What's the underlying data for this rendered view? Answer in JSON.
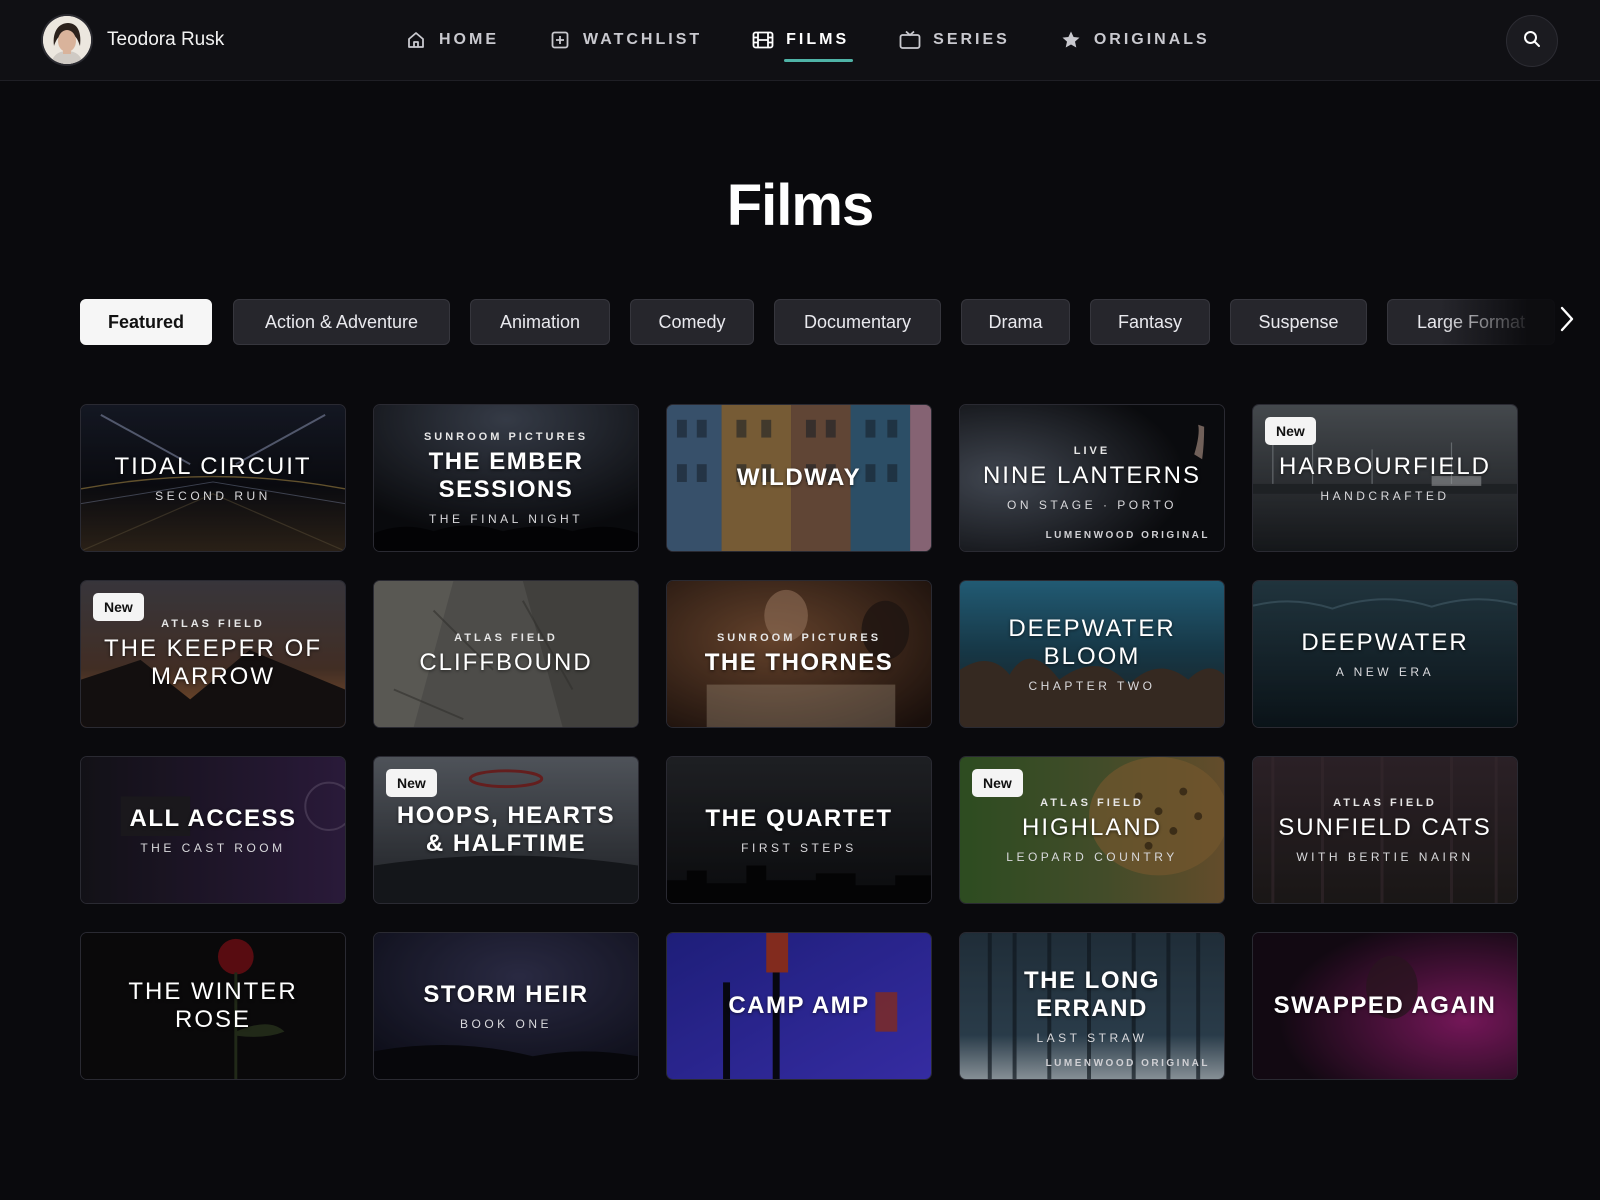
{
  "profile": {
    "name": "Teodora Rusk"
  },
  "nav": [
    {
      "label": "HOME",
      "icon": "home-icon",
      "active": false
    },
    {
      "label": "WATCHLIST",
      "icon": "plus-square-icon",
      "active": false
    },
    {
      "label": "FILMS",
      "icon": "film-icon",
      "active": true
    },
    {
      "label": "SERIES",
      "icon": "tv-icon",
      "active": false
    },
    {
      "label": "ORIGINALS",
      "icon": "star-icon",
      "active": false
    }
  ],
  "page": {
    "title": "Films"
  },
  "genres": [
    {
      "label": "Featured",
      "active": true
    },
    {
      "label": "Action & Adventure",
      "active": false
    },
    {
      "label": "Animation",
      "active": false
    },
    {
      "label": "Comedy",
      "active": false
    },
    {
      "label": "Documentary",
      "active": false
    },
    {
      "label": "Drama",
      "active": false
    },
    {
      "label": "Fantasy",
      "active": false
    },
    {
      "label": "Suspense",
      "active": false
    },
    {
      "label": "Large Format",
      "active": false
    }
  ],
  "colors": {
    "accent": "#4fb3a7",
    "chip_active_bg": "#f6f6f6",
    "chip_bg": "#26262c"
  },
  "cards": [
    {
      "title": "TIDAL CIRCUIT",
      "subtitle": "SECOND RUN",
      "kicker": "",
      "corner": "",
      "badge": ""
    },
    {
      "title": "THE EMBER SESSIONS",
      "subtitle": "THE FINAL NIGHT",
      "kicker": "SUNROOM PICTURES",
      "corner": "",
      "badge": ""
    },
    {
      "title": "WILDWAY",
      "subtitle": "",
      "kicker": "",
      "corner": "",
      "badge": ""
    },
    {
      "title": "NINE LANTERNS",
      "subtitle": "ON STAGE · PORTO",
      "kicker": "LIVE",
      "corner": "LUMENWOOD ORIGINAL",
      "badge": ""
    },
    {
      "title": "HARBOURFIELD",
      "subtitle": "HANDCRAFTED",
      "kicker": "",
      "corner": "",
      "badge": "New"
    },
    {
      "title": "THE KEEPER OF MARROW",
      "subtitle": "",
      "kicker": "ATLAS FIELD",
      "corner": "",
      "badge": "New"
    },
    {
      "title": "CLIFFBOUND",
      "subtitle": "",
      "kicker": "ATLAS FIELD",
      "corner": "",
      "badge": ""
    },
    {
      "title": "THE THORNES",
      "subtitle": "",
      "kicker": "SUNROOM PICTURES",
      "corner": "",
      "badge": ""
    },
    {
      "title": "DEEPWATER BLOOM",
      "subtitle": "CHAPTER TWO",
      "kicker": "",
      "corner": "",
      "badge": ""
    },
    {
      "title": "DEEPWATER",
      "subtitle": "A NEW ERA",
      "kicker": "",
      "corner": "",
      "badge": ""
    },
    {
      "title": "ALL ACCESS",
      "subtitle": "THE CAST ROOM",
      "kicker": "",
      "corner": "",
      "badge": ""
    },
    {
      "title": "HOOPS, HEARTS & HALFTIME",
      "subtitle": "",
      "kicker": "",
      "corner": "",
      "badge": "New"
    },
    {
      "title": "THE QUARTET",
      "subtitle": "FIRST STEPS",
      "kicker": "",
      "corner": "",
      "badge": ""
    },
    {
      "title": "HIGHLAND",
      "subtitle": "LEOPARD COUNTRY",
      "kicker": "ATLAS FIELD",
      "corner": "",
      "badge": "New"
    },
    {
      "title": "SUNFIELD CATS",
      "subtitle": "WITH BERTIE NAIRN",
      "kicker": "ATLAS FIELD",
      "corner": "",
      "badge": ""
    },
    {
      "title": "THE WINTER ROSE",
      "subtitle": "",
      "kicker": "",
      "corner": "",
      "badge": ""
    },
    {
      "title": "STORM HEIR",
      "subtitle": "BOOK ONE",
      "kicker": "",
      "corner": "",
      "badge": ""
    },
    {
      "title": "CAMP AMP",
      "subtitle": "",
      "kicker": "",
      "corner": "",
      "badge": ""
    },
    {
      "title": "THE LONG ERRAND",
      "subtitle": "LAST STRAW",
      "kicker": "",
      "corner": "LUMENWOOD ORIGINAL",
      "badge": ""
    },
    {
      "title": "SWAPPED AGAIN",
      "subtitle": "",
      "kicker": "",
      "corner": "",
      "badge": ""
    }
  ]
}
